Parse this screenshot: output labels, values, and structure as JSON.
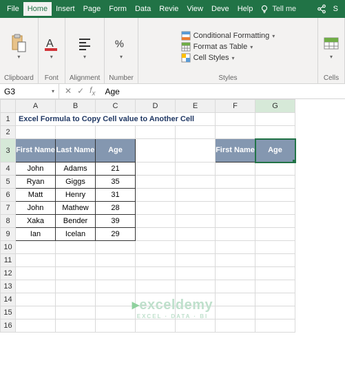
{
  "titlebar": {
    "tabs": [
      "File",
      "Home",
      "Insert",
      "Page",
      "Form",
      "Data",
      "Revie",
      "View",
      "Deve",
      "Help"
    ],
    "active_index": 1,
    "tellme": "Tell me"
  },
  "ribbon": {
    "clipboard": "Clipboard",
    "font": "Font",
    "alignment": "Alignment",
    "number": "Number",
    "styles": "Styles",
    "cells": "Cells",
    "cond_fmt": "Conditional Formatting",
    "fmt_table": "Format as Table",
    "cell_styles": "Cell Styles"
  },
  "namebox": {
    "ref": "G3",
    "formula": "Age"
  },
  "columns": [
    "A",
    "B",
    "C",
    "D",
    "E",
    "F",
    "G"
  ],
  "rows_count": 16,
  "title": "Excel Formula to Copy Cell value to Another Cell",
  "headers": {
    "first": "First Name",
    "last": "Last Name",
    "age": "Age"
  },
  "data": [
    {
      "first": "John",
      "last": "Adams",
      "age": "21"
    },
    {
      "first": "Ryan",
      "last": "Giggs",
      "age": "35"
    },
    {
      "first": "Matt",
      "last": "Henry",
      "age": "31"
    },
    {
      "first": "John",
      "last": "Mathew",
      "age": "28"
    },
    {
      "first": "Xaka",
      "last": "Bender",
      "age": "39"
    },
    {
      "first": "Ian",
      "last": "Icelan",
      "age": "29"
    }
  ],
  "side_headers": {
    "first": "First Name",
    "age": "Age"
  },
  "watermark": {
    "brand": "exceldemy",
    "tag": "EXCEL · DATA · BI"
  }
}
